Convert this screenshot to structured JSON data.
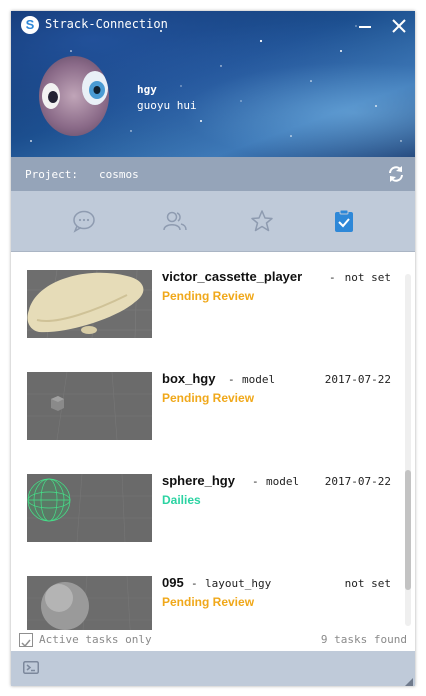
{
  "window": {
    "title": "Strack-Connection",
    "app_icon_letter": "S"
  },
  "user": {
    "name": "hgy",
    "login": "guoyu hui"
  },
  "project": {
    "label": "Project:",
    "name": "cosmos"
  },
  "tabs": [
    {
      "id": "chat",
      "icon": "chat-bubble-icon",
      "active": false
    },
    {
      "id": "people",
      "icon": "users-icon",
      "active": false
    },
    {
      "id": "favorites",
      "icon": "star-icon",
      "active": false
    },
    {
      "id": "tasks",
      "icon": "clipboard-check-icon",
      "active": true
    }
  ],
  "tasks": [
    {
      "name": "victor_cassette_player",
      "separator": "-",
      "type": "not set",
      "date": "",
      "status": "Pending Review",
      "status_color": "#f0a81a",
      "thumb": "blimp-model"
    },
    {
      "name": "box_hgy",
      "separator": "-",
      "type": "model",
      "date": "2017-07-22",
      "status": "Pending Review",
      "status_color": "#f0a81a",
      "thumb": "cube-model"
    },
    {
      "name": "sphere_hgy",
      "separator": "-",
      "type": "model",
      "date": "2017-07-22",
      "status": "Dailies",
      "status_color": "#2bd3a2",
      "thumb": "green-sphere-model"
    },
    {
      "name": "095",
      "separator": "-",
      "type": "layout_hgy",
      "date": "not set",
      "status": "Pending Review",
      "status_color": "#f0a81a",
      "thumb": "gray-sphere-model"
    }
  ],
  "footer": {
    "active_only_label": "Active tasks only",
    "count_text": "9 tasks found"
  },
  "colors": {
    "accent": "#2e88d8",
    "pending": "#f0a81a",
    "dailies": "#2bd3a2"
  }
}
